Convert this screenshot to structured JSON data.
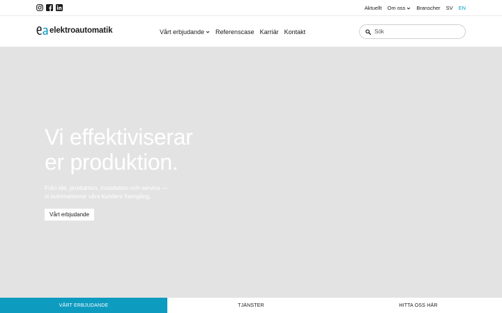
{
  "topbar": {
    "social": [
      {
        "icon": "instagram-icon"
      },
      {
        "icon": "facebook-icon"
      },
      {
        "icon": "linkedin-icon"
      }
    ],
    "links": {
      "aktuellt": "Aktuellt",
      "om_oss": "Om oss",
      "branscher": "Branscher",
      "sv": "SV",
      "en": "EN"
    }
  },
  "header": {
    "logo_text": "elektroautomatik",
    "nav": {
      "vart_erbjudande": "Vårt erbjudande",
      "referenscase": "Referenscase",
      "karriar": "Karriär",
      "kontakt": "Kontakt"
    },
    "search": {
      "placeholder": "Sök",
      "value": ""
    }
  },
  "hero": {
    "title_line1": "Vi effektiviserar",
    "title_line2": "er produktion.",
    "subtitle_line1": "Från idé, produktion, installation och service —",
    "subtitle_line2": "vi automatiserar våra kunders framgång.",
    "button_label": "Vårt erbjudande"
  },
  "tabs": [
    {
      "label": "VÅRT ERBJUDANDE",
      "active": true
    },
    {
      "label": "TJÄNSTER",
      "active": false
    },
    {
      "label": "HITTA OSS HÄR",
      "active": false
    }
  ],
  "colors": {
    "accent": "#0e9bc0",
    "hero_bg": "#e3e3e3",
    "lang_active": "#00a0c6"
  }
}
